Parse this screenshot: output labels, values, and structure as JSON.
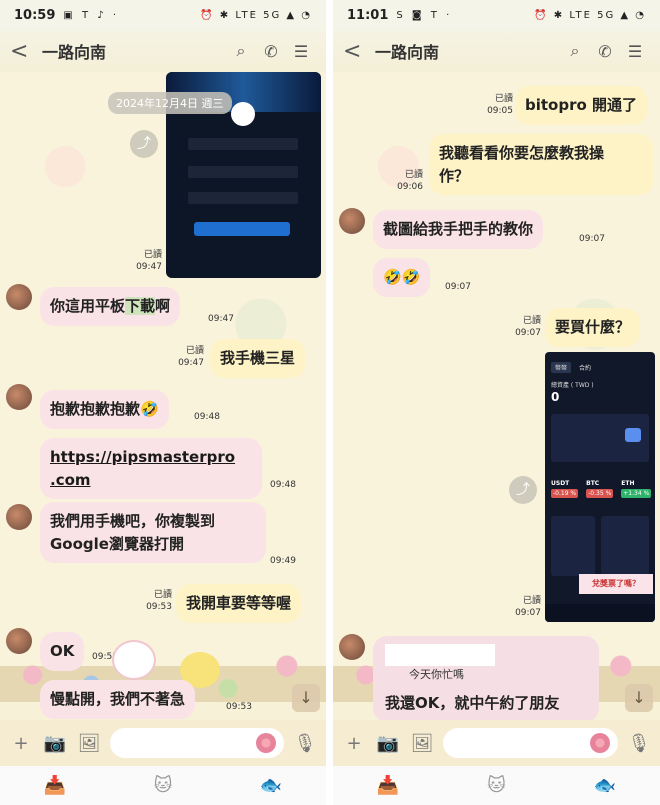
{
  "left": {
    "status": {
      "time": "10:59",
      "icons": "▣ 𝖳 ♪ ·",
      "sys": "⏰ ✱ LTE 5G ▲ ◔"
    },
    "header": {
      "back": "<",
      "title": "一路向南"
    },
    "date_chip": "2024年12月4日 週三",
    "image_meta": {
      "read": "已讀",
      "time": "09:47"
    },
    "messages": [
      {
        "dir": "in",
        "text_pre": "你這用平板",
        "text_hl": "下載",
        "text_post": "啊",
        "time": "09:47"
      },
      {
        "dir": "out",
        "read": "已讀",
        "time": "09:47",
        "text": "我手機三星"
      },
      {
        "dir": "in",
        "text": "抱歉抱歉抱歉🤣",
        "time": "09:48"
      },
      {
        "dir": "in",
        "line1": "https://pipsmasterpro",
        "line2": ".com",
        "time": "09:48"
      },
      {
        "dir": "in",
        "line1": "我們用手機吧，你複製到",
        "line2": "Google瀏覽器打開",
        "time": "09:49"
      },
      {
        "dir": "out",
        "read": "已讀",
        "time": "09:53",
        "text": "我開車要等等喔"
      },
      {
        "dir": "in",
        "text": "OK",
        "time": "09:53"
      },
      {
        "dir": "in",
        "text": "慢點開，我們不著急",
        "time": "09:53"
      }
    ]
  },
  "right": {
    "status": {
      "time": "11:01",
      "icons": "S ◙ 𝖳 ·",
      "sys": "⏰ ✱ LTE 5G ▲ ◔"
    },
    "header": {
      "back": "<",
      "title": "一路向南"
    },
    "messages": [
      {
        "dir": "out",
        "read": "已讀",
        "time": "09:05",
        "text": "bitopro 開通了"
      },
      {
        "dir": "out",
        "read": "已讀",
        "time": "09:06",
        "line1": "我聽看看你要怎麼教我操",
        "line2": "作？"
      },
      {
        "dir": "in",
        "text": "截圖給我手把手的教你",
        "time": "09:07"
      },
      {
        "dir": "in",
        "text": "🤣🤣",
        "time": "09:07"
      },
      {
        "dir": "out",
        "read": "已讀",
        "time": "09:07",
        "text": "要買什麼？"
      },
      {
        "dir": "out-image",
        "read": "已讀",
        "time": "09:07"
      },
      {
        "dir": "in",
        "quote": "今天你忙嗎",
        "text": "我還OK，就中午約了朋友"
      }
    ],
    "crypto": {
      "balance": "0",
      "title": "總資產 ( TWD )",
      "tabs": [
        "幣幣",
        "合約"
      ],
      "coins": [
        {
          "sym": "USDT",
          "chg": "-0.19 %",
          "color": "#d9534f"
        },
        {
          "sym": "BTC",
          "chg": "-0.35 %",
          "color": "#d9534f"
        },
        {
          "sym": "ETH",
          "chg": "+1.34 %",
          "color": "#2fb36b"
        }
      ],
      "banner": "兌獎票了嗎？"
    }
  },
  "input": {
    "plus": "+",
    "camera": "📷",
    "image": "🖼",
    "mic": "🎙"
  },
  "nav": {
    "icons": [
      "📥",
      "🐱",
      "🐟"
    ]
  },
  "colors": {
    "incoming": "#fae3e6",
    "outgoing": "#fdf3c6",
    "bg": "#f9f3dc"
  }
}
